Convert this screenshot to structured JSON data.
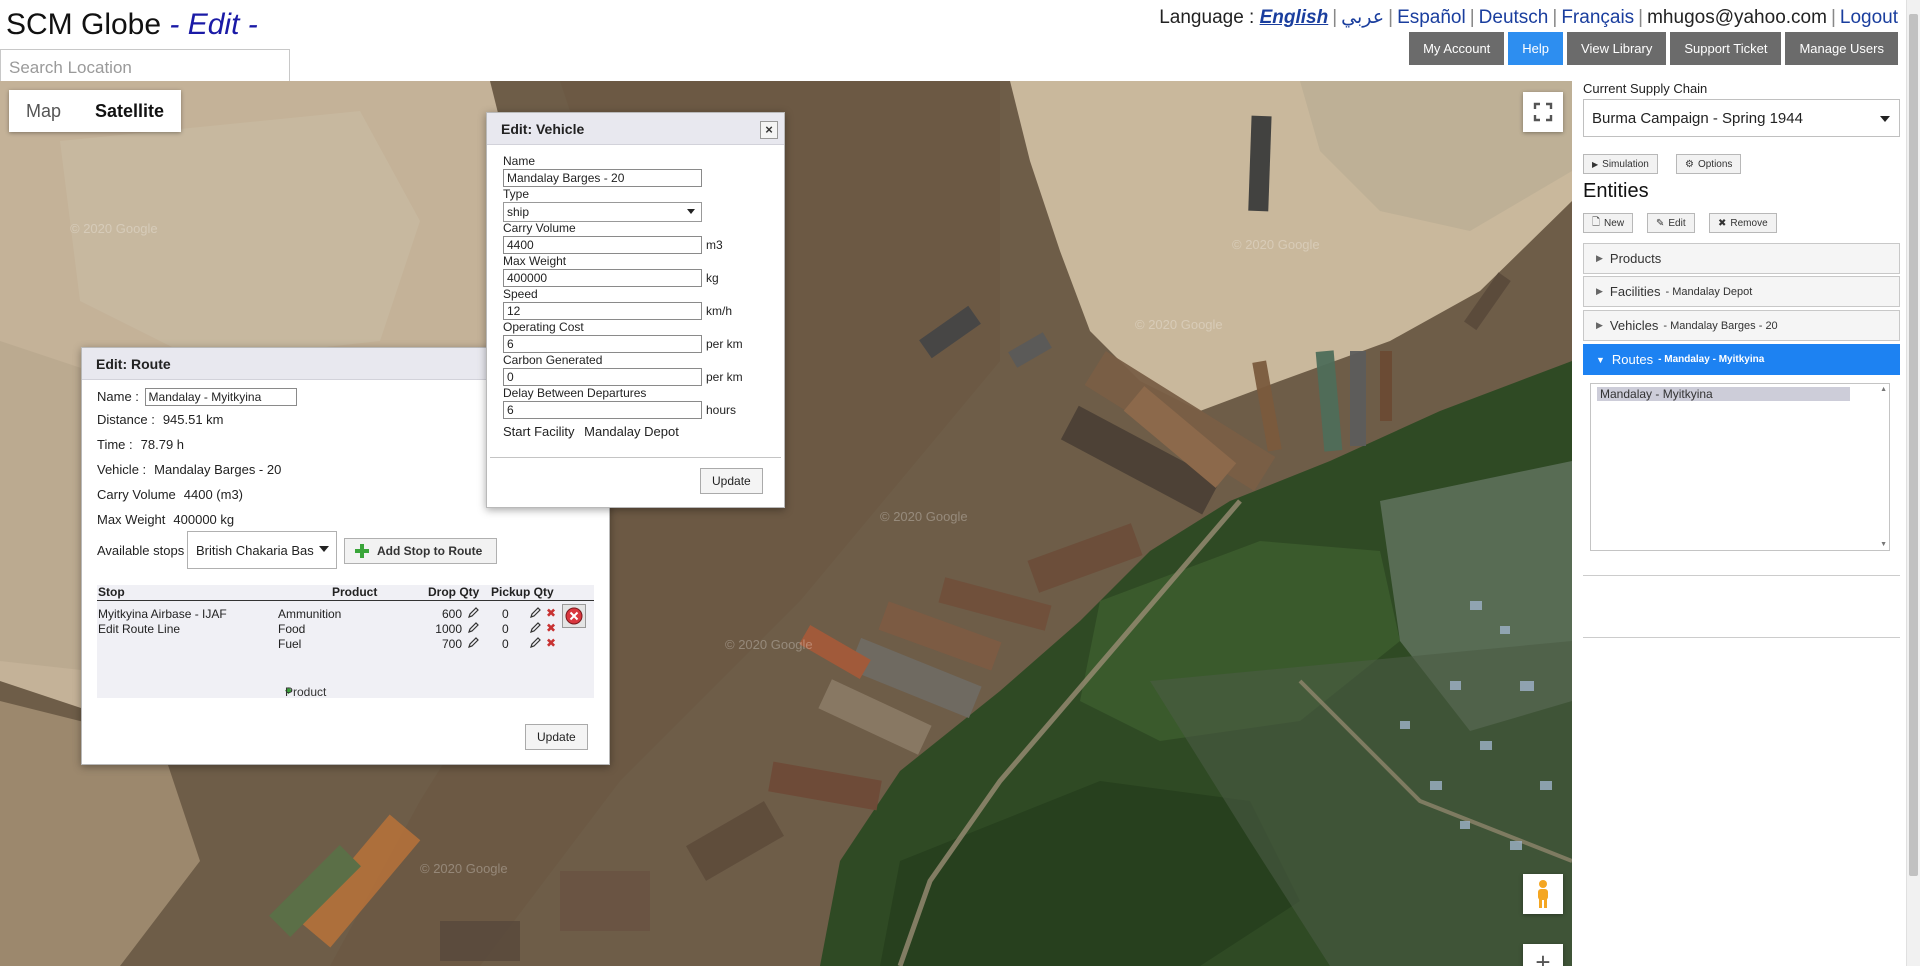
{
  "header": {
    "brand": "SCM Globe",
    "mode": "- Edit -",
    "search_placeholder": "Search Location",
    "language_label": "Language :",
    "languages": [
      "English",
      "عربي",
      "Español",
      "Deutsch",
      "Français"
    ],
    "active_language": "English",
    "user_email": "mhugos@yahoo.com",
    "logout": "Logout",
    "nav": {
      "my_account": "My Account",
      "help": "Help",
      "view_library": "View Library",
      "support_ticket": "Support Ticket",
      "manage_users": "Manage Users"
    }
  },
  "map": {
    "types": {
      "map": "Map",
      "satellite": "Satellite"
    },
    "selected_type": "Satellite",
    "watermark": "© 2020 Google"
  },
  "route_dialog": {
    "title": "Edit: Route",
    "name_label": "Name :",
    "name_value": "Mandalay - Myitkyina",
    "distance_label": "Distance :",
    "distance_value": "945.51 km",
    "time_label": "Time :",
    "time_value": "78.79 h",
    "vehicle_label": "Vehicle :",
    "vehicle_value": "Mandalay Barges - 20",
    "carry_volume_label": "Carry Volume",
    "carry_volume_value": "4400 (m3)",
    "max_weight_label": "Max Weight",
    "max_weight_value": "400000 kg",
    "available_stops_label": "Available stops",
    "available_stops_value": "British Chakaria Bas",
    "add_stop_button": "Add Stop to Route",
    "columns": {
      "stop": "Stop",
      "product": "Product",
      "drop_qty": "Drop Qty",
      "pickup_qty": "Pickup Qty"
    },
    "stop": {
      "name": "Myitkyina Airbase - IJAF",
      "edit_link": "Edit Route Line",
      "products": [
        {
          "product": "Ammunition",
          "drop": "600",
          "pickup": "0"
        },
        {
          "product": "Food",
          "drop": "1000",
          "pickup": "0"
        },
        {
          "product": "Fuel",
          "drop": "700",
          "pickup": "0"
        }
      ]
    },
    "add_product": "Product",
    "update_button": "Update"
  },
  "vehicle_dialog": {
    "title": "Edit: Vehicle",
    "close": "×",
    "name_label": "Name",
    "name_value": "Mandalay Barges - 20",
    "type_label": "Type",
    "type_value": "ship",
    "carry_volume_label": "Carry Volume",
    "carry_volume_value": "4400",
    "carry_volume_unit": "m3",
    "max_weight_label": "Max Weight",
    "max_weight_value": "400000",
    "max_weight_unit": "kg",
    "speed_label": "Speed",
    "speed_value": "12",
    "speed_unit": "km/h",
    "operating_cost_label": "Operating Cost",
    "operating_cost_value": "6",
    "operating_cost_unit": "per km",
    "carbon_label": "Carbon Generated",
    "carbon_value": "0",
    "carbon_unit": "per km",
    "delay_label": "Delay Between Departures",
    "delay_value": "6",
    "delay_unit": "hours",
    "start_facility_label": "Start Facility",
    "start_facility_value": "Mandalay Depot",
    "update_button": "Update"
  },
  "panel": {
    "current_sc_label": "Current Supply Chain",
    "current_sc_value": "Burma Campaign - Spring 1944",
    "simulation_button": "Simulation",
    "options_button": "Options",
    "entities_title": "Entities",
    "new_button": "New",
    "edit_button": "Edit",
    "remove_button": "Remove",
    "accordions": [
      {
        "label": "Products",
        "sub": ""
      },
      {
        "label": "Facilities",
        "sub": "- Mandalay Depot"
      },
      {
        "label": "Vehicles",
        "sub": "- Mandalay Barges - 20"
      },
      {
        "label": "Routes",
        "sub": "- Mandalay - Myitkyina"
      }
    ],
    "open_accordion": "Routes",
    "route_list": [
      "Mandalay - Myitkyina"
    ]
  }
}
